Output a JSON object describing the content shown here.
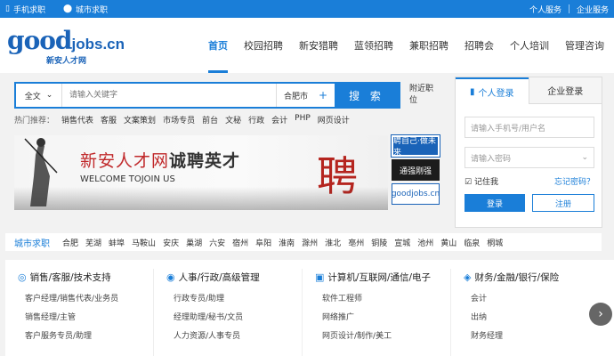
{
  "topbar": {
    "mobile": "手机求职",
    "city": "城市求职",
    "personal": "个人服务",
    "company": "企业服务"
  },
  "logo": {
    "good": "good",
    "jobs": "jobs.cn",
    "sub": "新安人才网"
  },
  "nav": [
    "首页",
    "校园招聘",
    "新安猎聘",
    "蓝领招聘",
    "兼职招聘",
    "招聘会",
    "个人培训",
    "管理咨询"
  ],
  "search": {
    "category": "全文",
    "placeholder": "请输入关键字",
    "city": "合肥市",
    "button": "搜 索",
    "nearby": "附近职位"
  },
  "hot": {
    "label": "热门推荐：",
    "items": [
      "销售代表",
      "客服",
      "文案策划",
      "市场专员",
      "前台",
      "文秘",
      "行政",
      "会计",
      "PHP",
      "网页设计"
    ]
  },
  "banner": {
    "title_red": "新安人才网",
    "title_dark": "诚聘英才",
    "subtitle": "WELCOME TOJOIN US",
    "char": "聘"
  },
  "ads": [
    "聘自己·做未来",
    "通强刚强",
    "goodjobs.cn"
  ],
  "login": {
    "tab_personal": "个人登录",
    "tab_company": "企业登录",
    "user_placeholder": "请输入手机号/用户名",
    "pwd_placeholder": "请输入密码",
    "remember": "记住我",
    "forgot": "忘记密码？",
    "login": "登录",
    "register": "注册"
  },
  "cities": {
    "label": "城市求职",
    "items": [
      "合肥",
      "芜湖",
      "蚌埠",
      "马鞍山",
      "安庆",
      "巢湖",
      "六安",
      "宿州",
      "阜阳",
      "淮南",
      "滁州",
      "淮北",
      "亳州",
      "铜陵",
      "宣城",
      "池州",
      "黄山",
      "临泉",
      "桐城"
    ]
  },
  "categories": [
    {
      "title": "销售/客服/技术支持",
      "items": [
        "客户经理/销售代表/业务员",
        "销售经理/主管",
        "客户服务专员/助理"
      ]
    },
    {
      "title": "人事/行政/高级管理",
      "items": [
        "行政专员/助理",
        "经理助理/秘书/文员",
        "人力资源/人事专员"
      ]
    },
    {
      "title": "计算机/互联网/通信/电子",
      "items": [
        "软件工程师",
        "网络推广",
        "网页设计/制作/美工"
      ]
    },
    {
      "title": "财务/金融/银行/保险",
      "items": [
        "会计",
        "出纳",
        "财务经理"
      ]
    }
  ]
}
